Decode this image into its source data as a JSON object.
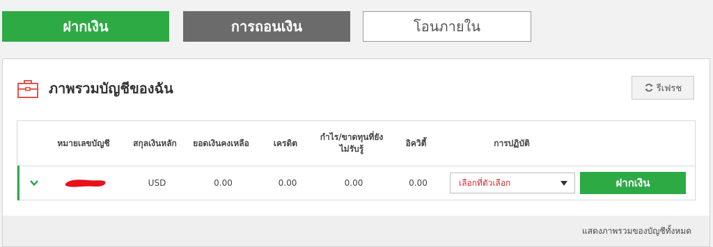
{
  "tabs": {
    "deposit": "ฝากเงิน",
    "withdraw": "การถอนเงิน",
    "transfer": "โอนภายใน"
  },
  "overview": {
    "title": "ภาพรวมบัญชีของฉัน",
    "refresh_label": "รีเฟรช"
  },
  "table": {
    "headers": {
      "account_number": "หมายเลขบัญชี",
      "base_currency": "สกุลเงินหลัก",
      "balance": "ยอดเงินคงเหลือ",
      "credit": "เครดิต",
      "unrealized_pl": "กำไร/ขาดทุนที่ยังไม่รับรู้",
      "equity": "อิควิตี้",
      "actions": "การปฏิบัติ"
    },
    "rows": [
      {
        "currency": "USD",
        "balance": "0.00",
        "credit": "0.00",
        "unrealized_pl": "0.00",
        "equity": "0.00",
        "select_placeholder": "เลือกที่ตัวเลือก",
        "deposit_label": "ฝากเงิน"
      }
    ]
  },
  "footer": {
    "show_all": "แสดงภาพรวมของบัญชีทั้งหมด"
  },
  "colors": {
    "accent_green": "#2eaa45",
    "tab_gray": "#6b6b6b",
    "select_red": "#d9262c",
    "briefcase_red": "#e0403a"
  }
}
